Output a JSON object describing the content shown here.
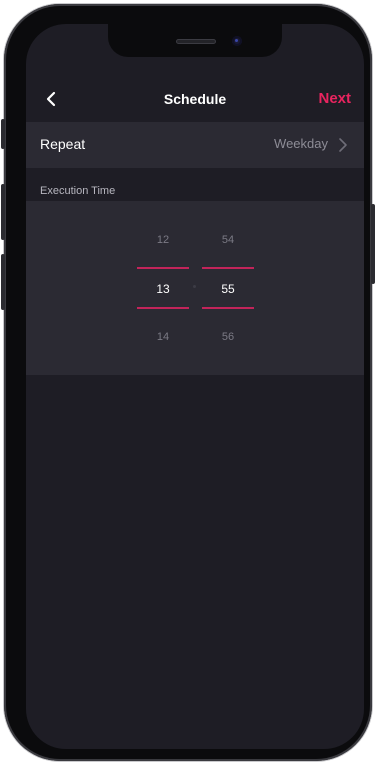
{
  "nav": {
    "back_icon": "chevron-left-icon",
    "title": "Schedule",
    "next_label": "Next",
    "accent_color": "#e8245f"
  },
  "repeat": {
    "label": "Repeat",
    "value": "Weekday",
    "chevron_icon": "chevron-right-icon"
  },
  "execution_time": {
    "label": "Execution Time",
    "hours": {
      "prev": "12",
      "selected": "13",
      "next": "14"
    },
    "minutes": {
      "prev": "54",
      "selected": "55",
      "next": "56"
    }
  },
  "colors": {
    "background": "#1e1d25",
    "panel": "#2b2a33",
    "selection_line": "#c2245a"
  }
}
